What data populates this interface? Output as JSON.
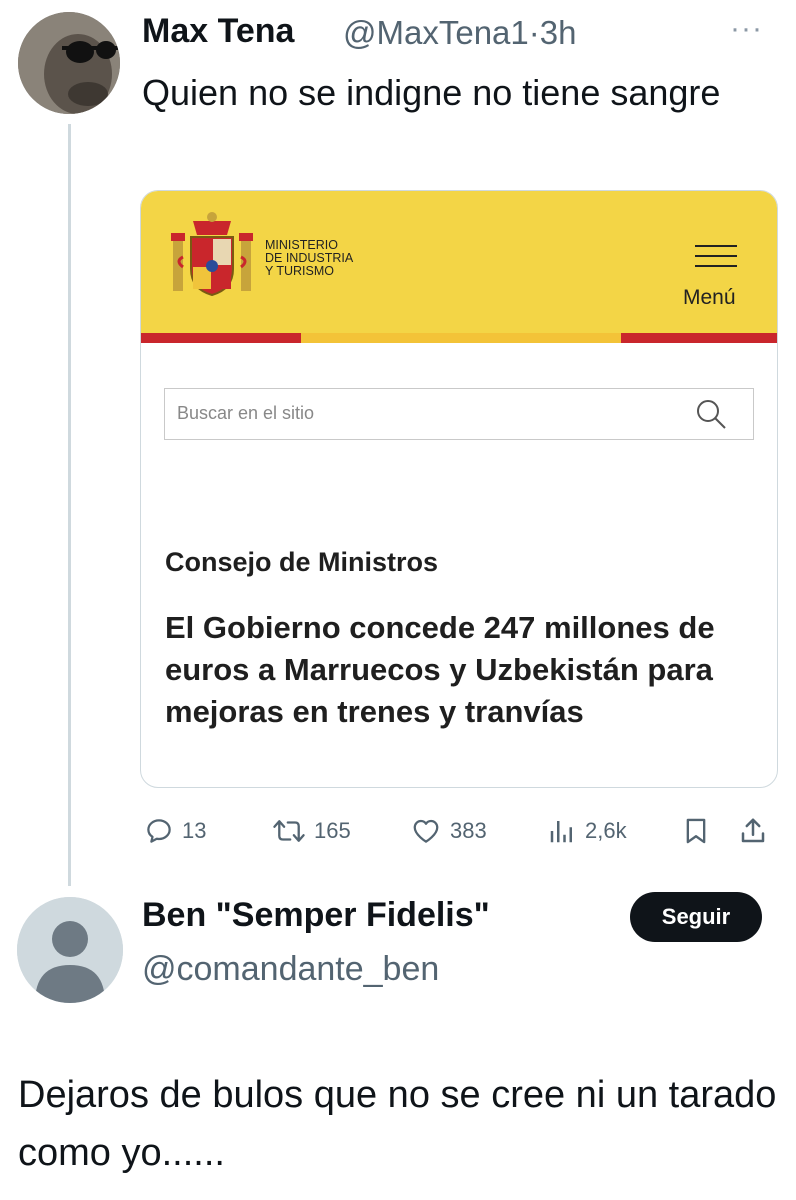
{
  "tweet": {
    "author_name": "Max Tena",
    "author_handle": "@MaxTena1",
    "time": "3h",
    "more": "···",
    "text": "Quien no se indigne no tiene sangre",
    "card": {
      "ministry_lines": [
        "MINISTERIO",
        "DE INDUSTRIA",
        "Y TURISMO"
      ],
      "menu_label": "Menú",
      "search_placeholder": "Buscar en el sitio",
      "kicker": "Consejo de Ministros",
      "headline": "El Gobierno concede 247 millones de euros a Marruecos y Uzbekistán para mejoras en trenes y tranvías",
      "colors": {
        "header": "#f3d546",
        "stripe_red": "#c9262c",
        "stripe_yellow": "#f3c338"
      }
    },
    "actions": {
      "replies": "13",
      "retweets": "165",
      "likes": "383",
      "views": "2,6k",
      "icons": [
        "reply-icon",
        "retweet-icon",
        "like-icon",
        "views-icon",
        "bookmark-icon",
        "share-icon"
      ]
    }
  },
  "reply": {
    "author_name": "Ben \"Semper Fidelis\"",
    "author_handle": "@comandante_ben",
    "follow_label": "Seguir",
    "text": "Dejaros de bulos que no se cree ni un tarado como yo......"
  }
}
